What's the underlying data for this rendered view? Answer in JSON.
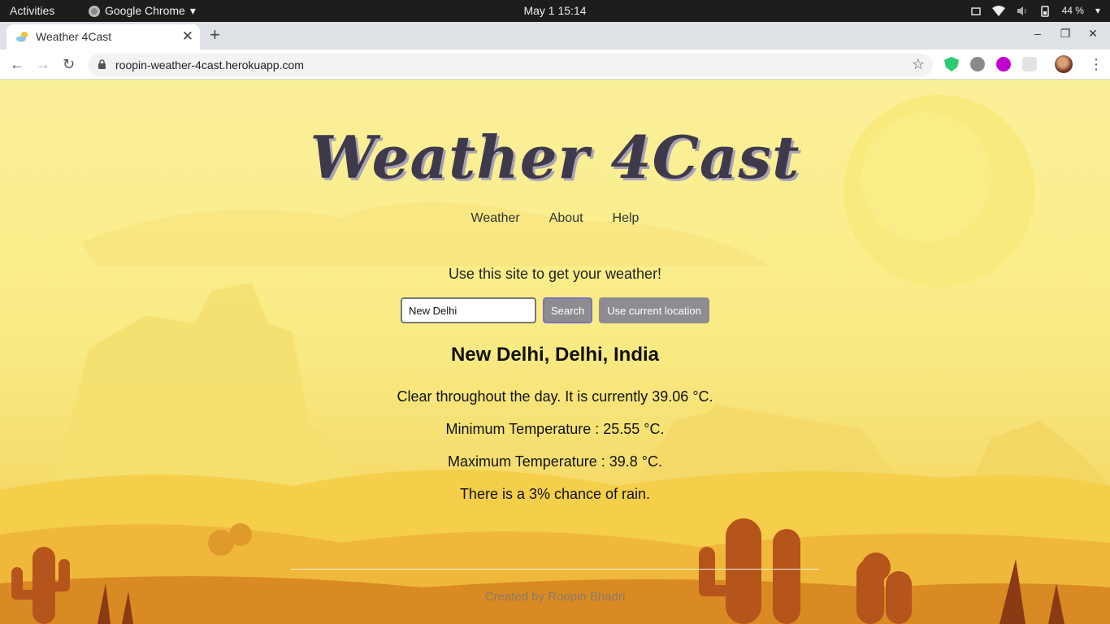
{
  "system_bar": {
    "activities": "Activities",
    "app_name": "Google Chrome",
    "clock": "May 1  15:14",
    "battery": "44 %"
  },
  "browser": {
    "tab_title": "Weather 4Cast",
    "url": "roopin-weather-4cast.herokuapp.com"
  },
  "site": {
    "title": "Weather 4Cast",
    "nav": [
      "Weather",
      "About",
      "Help"
    ],
    "intro": "Use this site to get your weather!",
    "search": {
      "value": "New Delhi",
      "search_label": "Search",
      "location_label": "Use current location"
    },
    "result": {
      "location": "New Delhi, Delhi, India",
      "summary": "Clear throughout the day. It is currently 39.06 °C.",
      "min_temp": "Minimum Temperature : 25.55 °C.",
      "max_temp": "Maximum Temperature : 39.8 °C.",
      "rain": "There is a 3% chance of rain."
    },
    "footer": "Created by Roopin Bhadri"
  }
}
